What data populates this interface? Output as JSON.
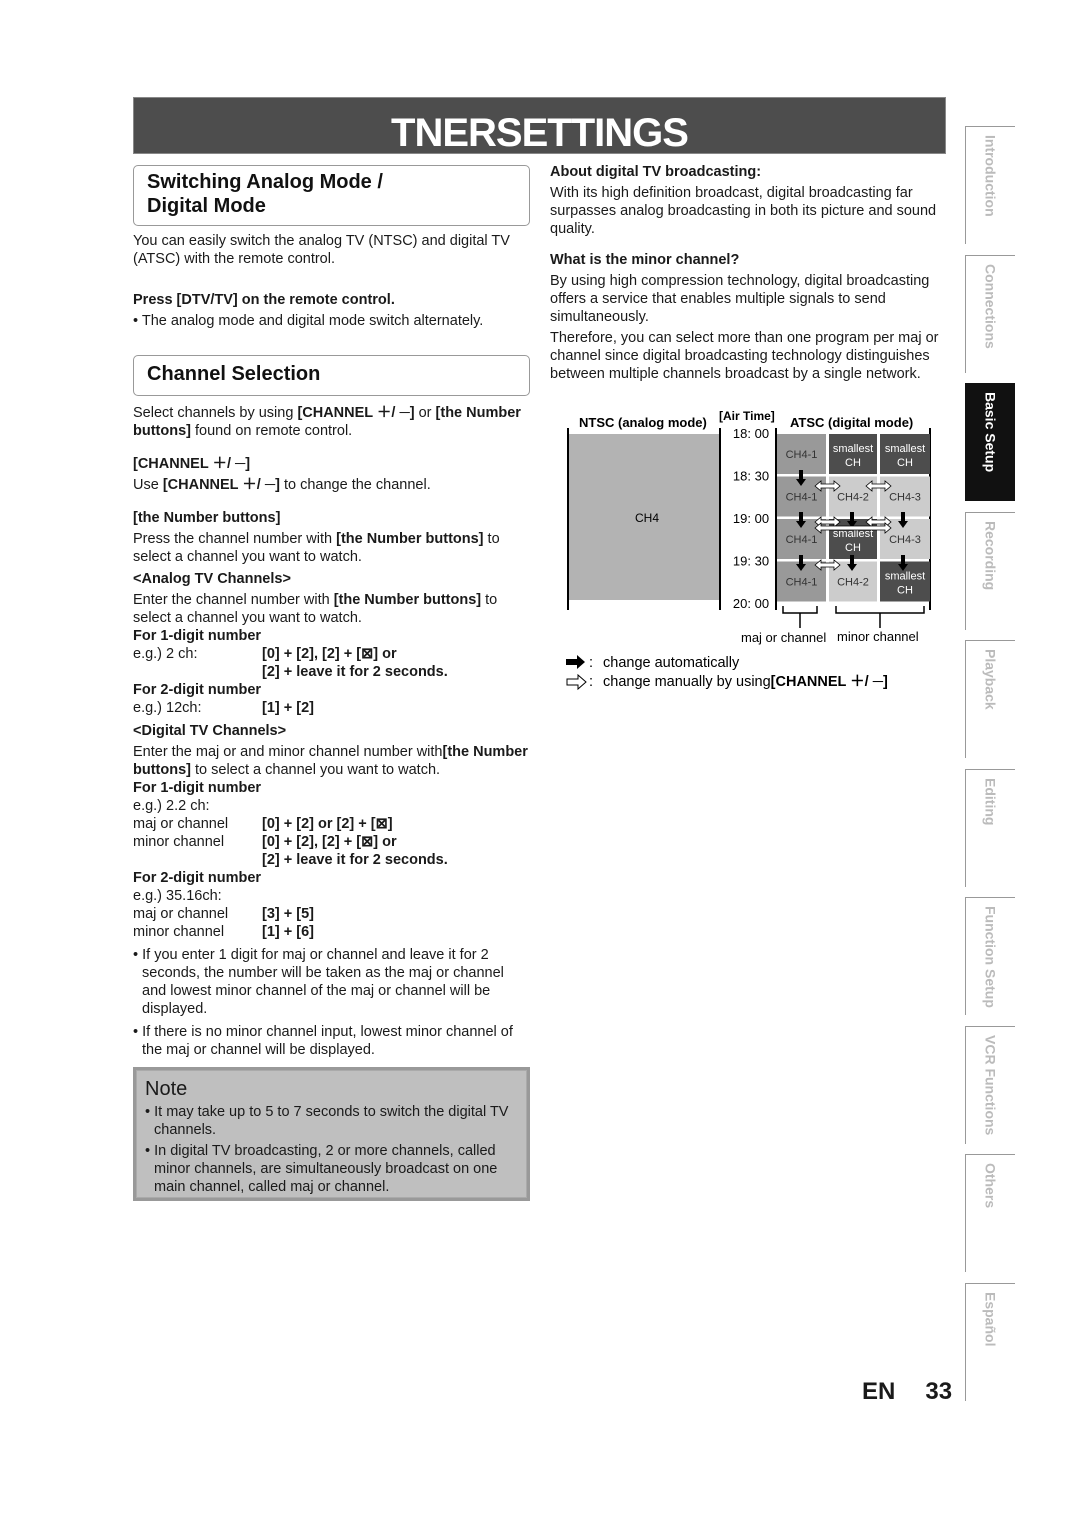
{
  "title": "TNERSETTINGS",
  "left": {
    "section1_title_l1": "Switching Analog Mode /",
    "section1_title_l2": "Digital Mode",
    "section1_intro": "You can easily switch the analog TV (NTSC) and digital TV (ATSC) with the remote control.",
    "press_heading": "Press [DTV/TV] on the remote control.",
    "press_bullet": "• The analog mode and digital mode switch alternately.",
    "section2_title": "Channel Selection",
    "select_1": "Select channels by using ",
    "select_b1": "[CHANNEL ＋/ ─]",
    "select_2": " or ",
    "select_b2": "[the Number buttons]",
    "select_3": " found on remote control.",
    "ch_heading": "[CHANNEL ＋/ ─]",
    "ch_use_1": "Use ",
    "ch_use_b": "[CHANNEL ＋/ ─]",
    "ch_use_2": " to change the channel.",
    "num_heading": "[the Number buttons]",
    "num_1": "Press the channel number with ",
    "num_b": "[the Number buttons]",
    "num_2": " to select a channel you want to watch.",
    "analog_heading": "<Analog TV Channels>",
    "analog_1": "Enter the channel number with ",
    "analog_b": "[the Number buttons]",
    "analog_2": " to select a channel you want to watch.",
    "a1_heading": "For 1-digit number",
    "a1_eg": "e.g.) 2 ch:",
    "a1_v1": "[0] + [2], [2] + [⊠] or",
    "a1_v2": "[2] + leave it for 2 seconds.",
    "a2_heading": "For 2-digit number",
    "a2_eg": "e.g.) 12ch:",
    "a2_v": "[1] + [2]",
    "digital_heading": "<Digital TV Channels>",
    "digital_1": "Enter the maj or and minor channel number with",
    "digital_b": "[the Number buttons]",
    "digital_2": " to select a channel you want to watch.",
    "d1_heading": "For 1-digit number",
    "d1_eg": "e.g.) 2.2 ch:",
    "d1_major_k": "maj or channel",
    "d1_major_v": "[0] + [2] or [2] + [⊠]",
    "d1_minor_k": "minor channel",
    "d1_minor_v1": "[0] + [2], [2] + [⊠] or",
    "d1_minor_v2": "[2]  + leave it for 2 seconds.",
    "d2_heading": "For 2-digit number",
    "d2_eg": "e.g.) 35.16ch:",
    "d2_major_k": "maj or channel",
    "d2_major_v": "[3] + [5]",
    "d2_minor_k": "minor channel",
    "d2_minor_v": "[1] + [6]",
    "bullet1": "• If you enter 1 digit for maj or channel and leave it for 2 seconds, the number will be taken as the maj or channel and lowest minor channel of the maj or channel will be displayed.",
    "bullet2": "• If there is no minor channel input, lowest minor channel of the maj or channel will be displayed."
  },
  "note": {
    "heading": "Note",
    "items": [
      "• It may take up to 5 to 7 seconds to switch the digital TV channels.",
      "• In digital TV broadcasting, 2 or more channels, called minor channels, are simultaneously broadcast on one main channel, called maj or channel."
    ]
  },
  "right": {
    "about_heading": "About digital TV broadcasting:",
    "about_text": "With its high definition broadcast, digital broadcasting far surpasses analog broadcasting in both its picture and sound quality.",
    "minor_heading": "What is the minor channel?",
    "minor_text1": "By using high compression technology, digital broadcasting offers a service that enables multiple signals to send simultaneously.",
    "minor_text2": "Therefore, you can select more than one program per maj or channel since digital broadcasting technology distinguishes between multiple channels broadcast by a single network."
  },
  "diagram": {
    "ntsc_label": "NTSC (analog mode)",
    "airtime_label": "[Air Time]",
    "atsc_label": "ATSC (digital mode)",
    "ntsc_channel": "CH4",
    "times": [
      "18: 00",
      "18: 30",
      "19: 00",
      "19: 30",
      "20: 00"
    ],
    "cells": [
      [
        {
          "t1": "CH4-1",
          "t2": "",
          "shade": "medium"
        },
        {
          "t1": "smallest",
          "t2": "CH",
          "shade": "dark"
        },
        {
          "t1": "smallest",
          "t2": "CH",
          "shade": "dark"
        }
      ],
      [
        {
          "t1": "CH4-1",
          "t2": "",
          "shade": "medium"
        },
        {
          "t1": "CH4-2",
          "t2": "",
          "shade": "light"
        },
        {
          "t1": "CH4-3",
          "t2": "",
          "shade": "light"
        }
      ],
      [
        {
          "t1": "CH4-1",
          "t2": "",
          "shade": "medium"
        },
        {
          "t1": "smallest",
          "t2": "CH",
          "shade": "dark"
        },
        {
          "t1": "CH4-3",
          "t2": "",
          "shade": "light"
        }
      ],
      [
        {
          "t1": "CH4-1",
          "t2": "",
          "shade": "medium"
        },
        {
          "t1": "CH4-2",
          "t2": "",
          "shade": "light"
        },
        {
          "t1": "smallest",
          "t2": "CH",
          "shade": "dark"
        }
      ]
    ],
    "major_label": "maj or channel",
    "minor_label": "minor channel",
    "legend_auto": "change automatically",
    "legend_manual_1": "change manually by using",
    "legend_manual_b": "[CHANNEL ＋/ ─]",
    "legend_sep": ":",
    "colors": {
      "ntsc": "#b3b3b3",
      "medium": "#999999",
      "light": "#cccccc",
      "dark": "#4d4d4d"
    }
  },
  "side_tabs": [
    {
      "label": "Introduction",
      "active": false
    },
    {
      "label": "Connections",
      "active": false
    },
    {
      "label": "Basic Setup",
      "active": true
    },
    {
      "label": "Recording",
      "active": false
    },
    {
      "label": "Playback",
      "active": false
    },
    {
      "label": "Editing",
      "active": false
    },
    {
      "label": "Function Setup",
      "active": false
    },
    {
      "label": "VCR Functions",
      "active": false
    },
    {
      "label": "Others",
      "active": false
    },
    {
      "label": "Español",
      "active": false
    }
  ],
  "footer": {
    "lang": "EN",
    "page": "33"
  }
}
